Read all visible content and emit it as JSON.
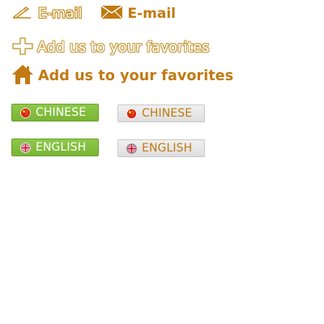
{
  "email_links": {
    "outline_label": "E-mail",
    "solid_label": "E-mail",
    "accent_color": "#c07a10"
  },
  "favorites_links": {
    "outline_label": "Add us to your favorites",
    "solid_label": "Add us to your favorites",
    "accent_color": "#c27a12"
  },
  "language_buttons": {
    "chinese_green": {
      "label": "CHINESE",
      "icon": "china-flag-icon",
      "background": "#86c043"
    },
    "chinese_gray": {
      "label": "CHINESE",
      "icon": "china-flag-icon",
      "background": "#e6e6e6"
    },
    "english_green": {
      "label": "ENGLISH",
      "icon": "uk-flag-icon",
      "background": "#86c043"
    },
    "english_gray": {
      "label": "ENGLISH",
      "icon": "uk-flag-icon",
      "background": "#e6e6e6"
    }
  }
}
